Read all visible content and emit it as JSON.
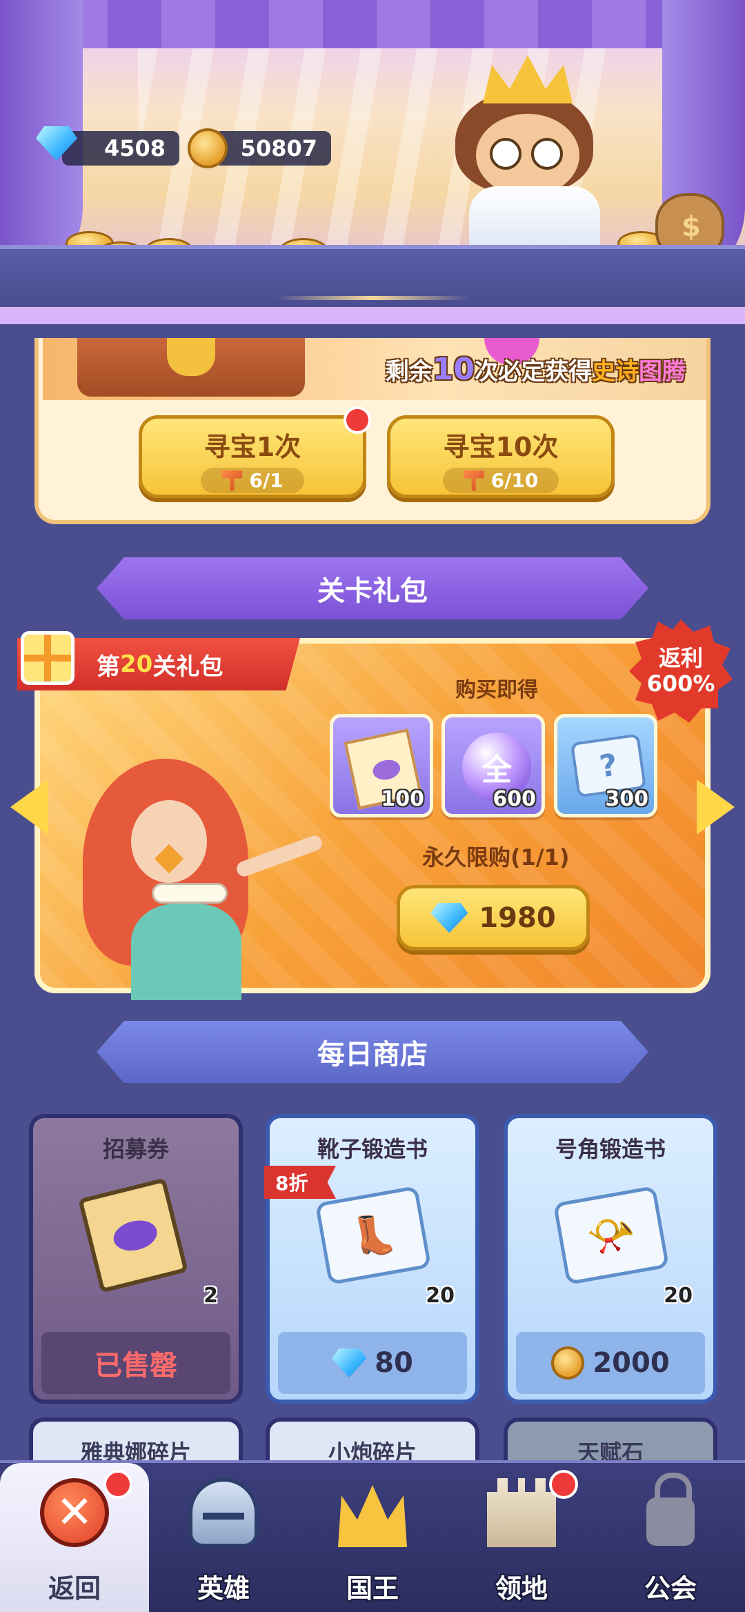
{
  "currency": {
    "gems": "4508",
    "gold": "50807",
    "gem_icon": "gem-icon",
    "gold_icon": "gold-coin-icon"
  },
  "treasure": {
    "notice_prefix": "剩余",
    "notice_count": "10",
    "notice_mid": "次必定获得",
    "notice_epic": "史诗",
    "notice_totem": "图腾",
    "hunt_once_label": "寻宝1次",
    "hunt_once_progress": "6/1",
    "hunt_ten_label": "寻宝10次",
    "hunt_ten_progress": "6/10"
  },
  "level_pack": {
    "section_title": "关卡礼包",
    "tag_prefix": "第",
    "tag_level": "20",
    "tag_suffix": "关礼包",
    "rebate_line1": "返利",
    "rebate_line2": "600%",
    "buy_get": "购买即得",
    "items": [
      {
        "name": "recruit-ticket",
        "qty": "100"
      },
      {
        "name": "universal-orb",
        "glyph": "全",
        "qty": "600"
      },
      {
        "name": "mystery-scroll",
        "glyph": "?",
        "qty": "300"
      }
    ],
    "limit": "永久限购(1/1)",
    "price": "1980"
  },
  "daily_shop": {
    "section_title": "每日商店",
    "cards": [
      {
        "title": "招募券",
        "qty": "2",
        "footer": "已售罄"
      },
      {
        "title": "靴子锻造书",
        "qty": "20",
        "discount": "8折",
        "price": "80",
        "currency": "gem"
      },
      {
        "title": "号角锻造书",
        "qty": "20",
        "price": "2000",
        "currency": "gold"
      }
    ],
    "next_row": [
      "雅典娜碎片",
      "小炮碎片",
      "天赋石"
    ]
  },
  "nav": {
    "items": [
      {
        "label": "返回",
        "icon": "close-icon",
        "badge": true
      },
      {
        "label": "英雄",
        "icon": "helmet-icon",
        "badge": false
      },
      {
        "label": "国王",
        "icon": "crown-icon",
        "badge": false
      },
      {
        "label": "领地",
        "icon": "castle-icon",
        "badge": true
      },
      {
        "label": "公会",
        "icon": "lock-icon",
        "badge": false
      }
    ]
  },
  "colors": {
    "background": "#4a4d8e",
    "accent_gold": "#f6c437",
    "badge_red": "#ef3a3a"
  }
}
